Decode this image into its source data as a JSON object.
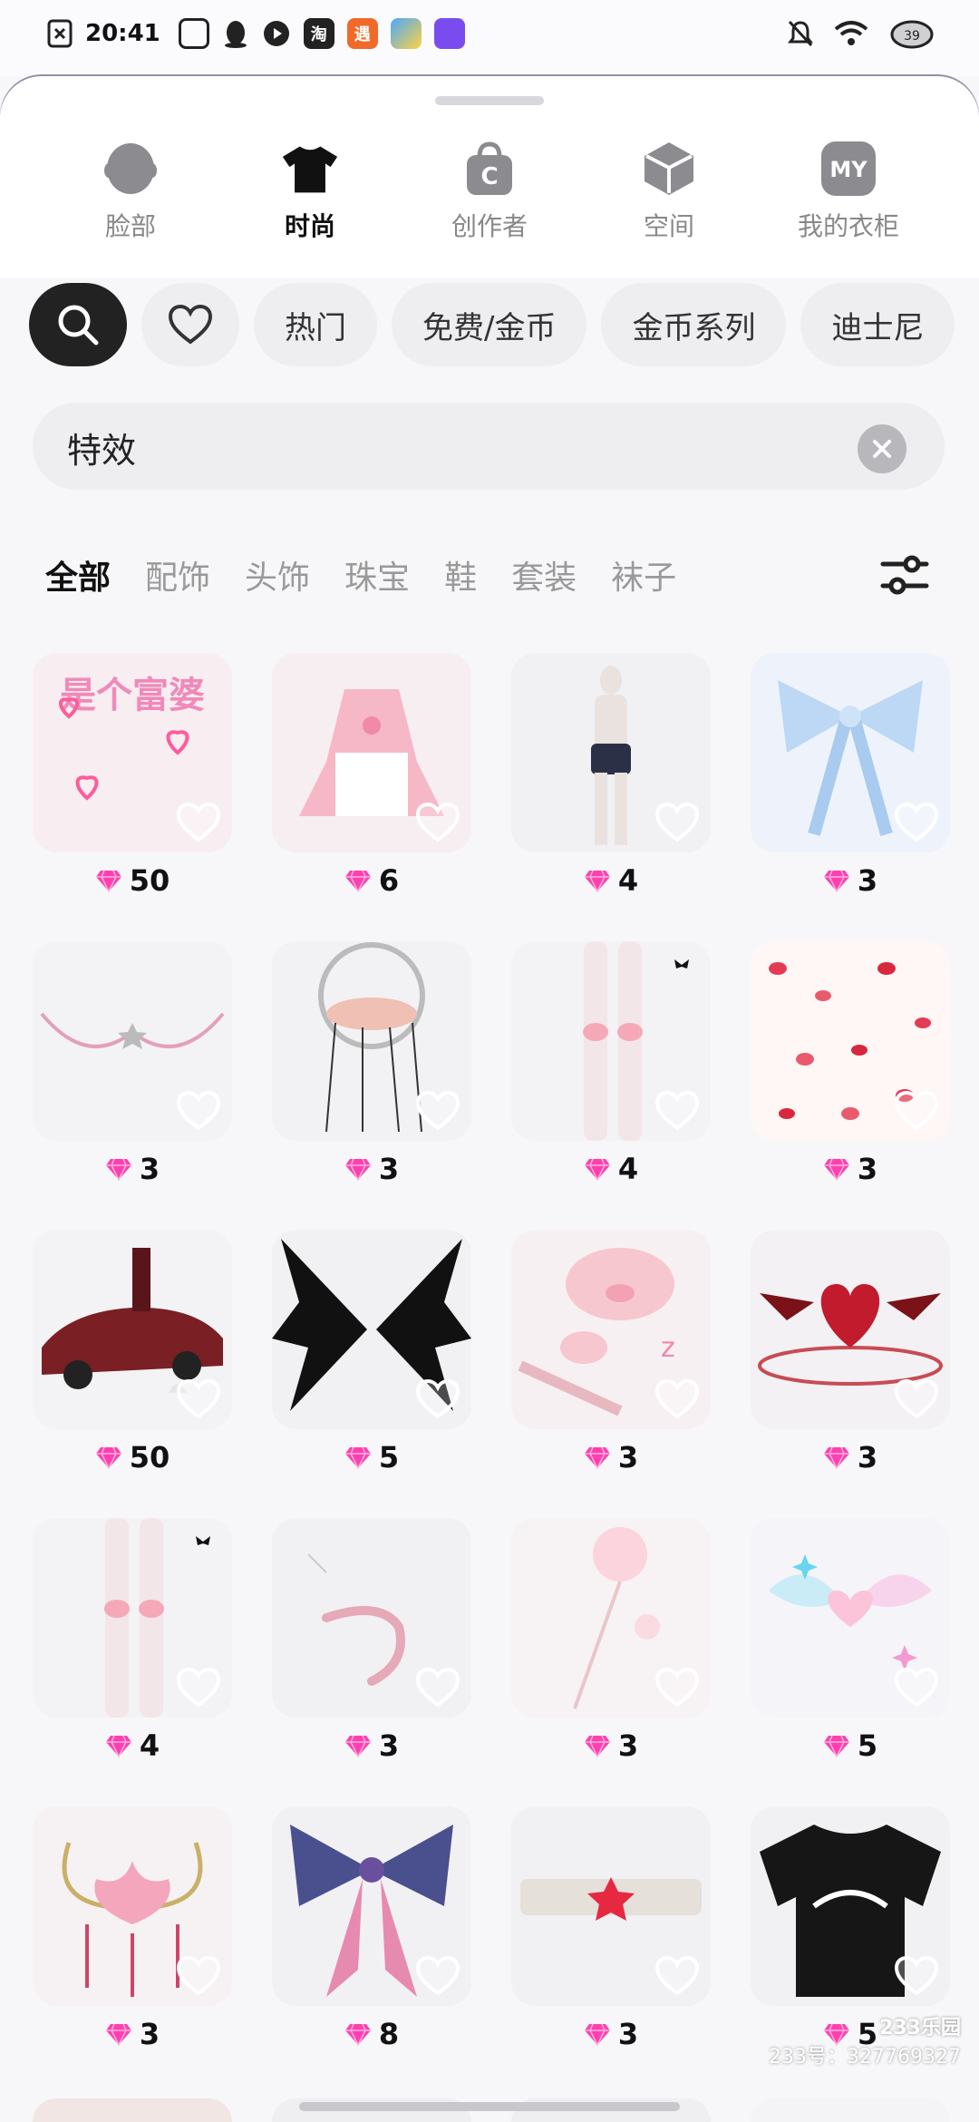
{
  "status": {
    "time": "20:41",
    "apps": [
      "淘",
      "遇"
    ]
  },
  "nav": [
    {
      "label": "脸部",
      "icon": "face-icon"
    },
    {
      "label": "时尚",
      "icon": "tshirt-icon"
    },
    {
      "label": "创作者",
      "icon": "creator-bag-icon",
      "glyph": "C"
    },
    {
      "label": "空间",
      "icon": "space-cube-icon"
    },
    {
      "label": "我的衣柜",
      "icon": "my-wardrobe-icon",
      "glyph": "MY"
    }
  ],
  "chips": [
    "热门",
    "免费/金币",
    "金币系列",
    "迪士尼"
  ],
  "search": {
    "value": "特效"
  },
  "categories": [
    "全部",
    "配饰",
    "头饰",
    "珠宝",
    "鞋",
    "套装",
    "袜子"
  ],
  "items": [
    {
      "price": "50",
      "name": "rich-woman-text-effect",
      "bg": "#f8eef2",
      "text": "是个富婆"
    },
    {
      "price": "6",
      "name": "pink-maid-dress",
      "bg": "#f6eef0"
    },
    {
      "price": "4",
      "name": "body-shorts-model",
      "bg": "#f1f1f4"
    },
    {
      "price": "3",
      "name": "blue-bow",
      "bg": "#eef3fb"
    },
    {
      "price": "3",
      "name": "star-chain-necklace",
      "bg": "#f3f3f6"
    },
    {
      "price": "3",
      "name": "marionette-hand",
      "bg": "#f2f2f4"
    },
    {
      "price": "4",
      "name": "pink-knee-legs",
      "bg": "#f3f2f4"
    },
    {
      "price": "3",
      "name": "rose-petals-effect",
      "bg": "#fff6f6"
    },
    {
      "price": "50",
      "name": "red-sports-car",
      "bg": "#f3f2f4"
    },
    {
      "price": "5",
      "name": "black-wings",
      "bg": "#f1f1f3"
    },
    {
      "price": "3",
      "name": "pink-pig-stickers",
      "bg": "#f7f0f2"
    },
    {
      "price": "3",
      "name": "winged-heart-circle",
      "bg": "#f3f1f3"
    },
    {
      "price": "4",
      "name": "pink-knee-legs-2",
      "bg": "#f3f2f4"
    },
    {
      "price": "3",
      "name": "pink-tail",
      "bg": "#f1f1f3"
    },
    {
      "price": "3",
      "name": "pink-wand",
      "bg": "#f7f2f4"
    },
    {
      "price": "5",
      "name": "pastel-wings-sparkles",
      "bg": "#f4f4f9"
    },
    {
      "price": "3",
      "name": "lotus-crown",
      "bg": "#f6f2f3"
    },
    {
      "price": "8",
      "name": "galaxy-bow",
      "bg": "#f1f1f4"
    },
    {
      "price": "3",
      "name": "star-headband",
      "bg": "#f1f1f3"
    },
    {
      "price": "5",
      "name": "black-tshirt",
      "bg": "#f1f1f3"
    }
  ],
  "watermark": {
    "brand": "233乐园",
    "id": "233号：327769327"
  },
  "colors": {
    "gem": "#ff3fb0",
    "accent": "#222222"
  }
}
